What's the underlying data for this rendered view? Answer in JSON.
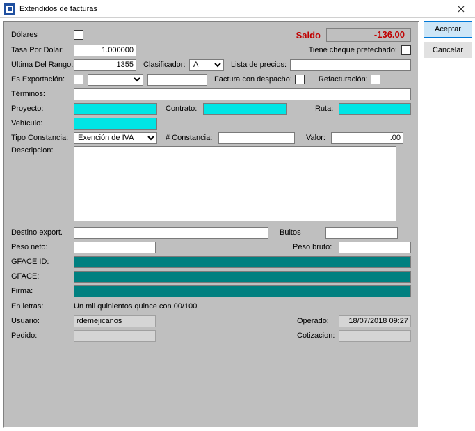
{
  "window": {
    "title": "Extendidos de facturas"
  },
  "actions": {
    "accept": "Aceptar",
    "cancel": "Cancelar"
  },
  "saldo": {
    "label": "Saldo",
    "value": "-136.00"
  },
  "labels": {
    "dolares": "Dólares",
    "tasa": "Tasa Por Dolar:",
    "cheque_pref": "Tiene cheque prefechado:",
    "ultima_rango": "Ultima Del Rango:",
    "clasificador": "Clasificador:",
    "lista_precios": "Lista de precios:",
    "exportacion": "Es Exportación:",
    "fact_despacho": "Factura con despacho:",
    "refacturacion": "Refacturación:",
    "terminos": "Términos:",
    "proyecto": "Proyecto:",
    "contrato": "Contrato:",
    "ruta": "Ruta:",
    "vehiculo": "Vehículo:",
    "tipo_const": "Tipo Constancia:",
    "num_const": "# Constancia:",
    "valor": "Valor:",
    "descripcion": "Descripcion:",
    "destino": "Destino export.",
    "bultos": "Bultos",
    "peso_neto": "Peso neto:",
    "peso_bruto": "Peso bruto:",
    "gface_id": "GFACE ID:",
    "gface": "GFACE:",
    "firma": "Firma:",
    "en_letras": "En letras:",
    "usuario": "Usuario:",
    "operado": "Operado:",
    "pedido": "Pedido:",
    "cotizacion": "Cotizacion:"
  },
  "values": {
    "tasa": "1.000000",
    "ultima_rango": "1355",
    "clasificador": "A",
    "exportacion": "",
    "lista_precios": "",
    "terminos": "",
    "proyecto": "",
    "contrato": "",
    "ruta": "",
    "vehiculo": "",
    "tipo_const": "Exención de IVA",
    "num_const": "",
    "valor": ".00",
    "descripcion": "",
    "destino": "",
    "bultos": "",
    "peso_neto": "",
    "peso_bruto": "",
    "gface_id": "",
    "gface": "",
    "firma": "",
    "en_letras": "Un mil quinientos quince con 00/100",
    "usuario": "rdemejicanos",
    "operado": "18/07/2018 09:27",
    "pedido": "",
    "cotizacion": ""
  },
  "colors": {
    "highlight": "#00e5e5",
    "teal": "#008080",
    "saldo": "#c00000",
    "panel": "#bfbfbf"
  }
}
